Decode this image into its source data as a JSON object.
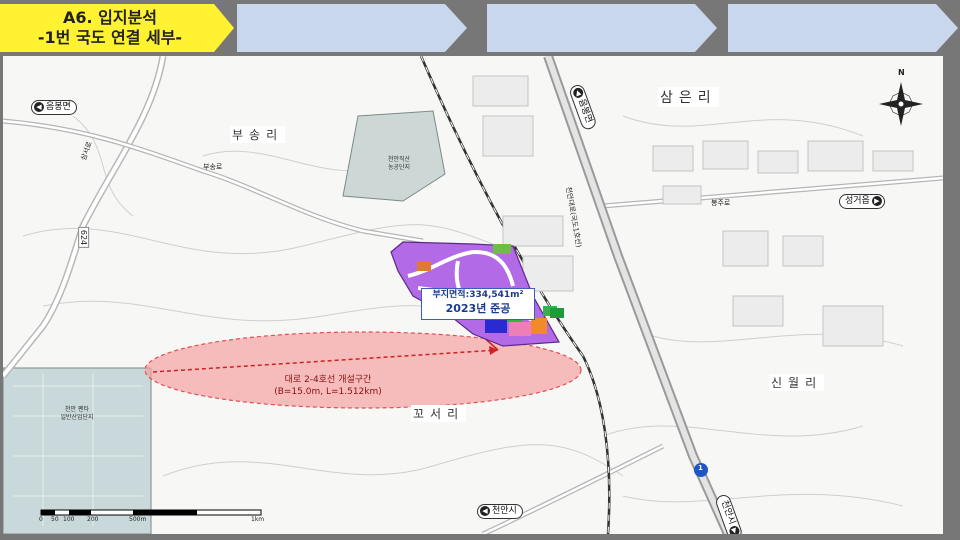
{
  "header": {
    "title_line1": "A6. 입지분석",
    "title_line2": "-1번 국도 연결 세부-",
    "active_color": "#fff233",
    "inactive_color": "#c9d7ee"
  },
  "map": {
    "villages": {
      "busong": "부송리",
      "sameun": "삼은리",
      "sinwol": "신월리",
      "goseo": "꼬서리"
    },
    "signs": {
      "eumbong": "음봉면",
      "eumbong2": "음봉면",
      "seonggeo": "성거읍",
      "cheonan_bottom": "천안시",
      "cheonan_right": "천안시"
    },
    "complexes": {
      "jiksan_line1": "천안직산",
      "jiksan_line2": "농공단지",
      "complex_sw_line1": "천안 펜타",
      "complex_sw_line2": "일반산업단지"
    },
    "roads": {
      "busong_ro": "부송로",
      "bongju_ro": "봉주로",
      "samseo_ro": "삼서로",
      "route_624": "624",
      "route_1": "1",
      "national_road": "천안대로(국도1호선)"
    },
    "site": {
      "area": "부지면적:334,541m²",
      "year": "2023년 준공"
    },
    "new_road": {
      "line1": "대로 2-4호선 개설구간",
      "line2": "(B=15.0m, L=1.512km)"
    },
    "scale": {
      "t0": "0",
      "t1": "50",
      "t2": "100",
      "t3": "200",
      "t4": "500m",
      "t5": "1km"
    },
    "compass_label": "N"
  }
}
